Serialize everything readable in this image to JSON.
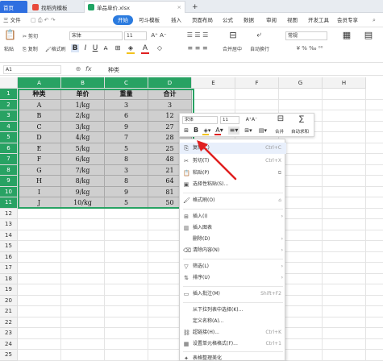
{
  "tabs": [
    {
      "label": "首页"
    },
    {
      "label": "找稻壳模板"
    },
    {
      "label": "单品单价.xlsx"
    },
    {
      "label": "+"
    }
  ],
  "menu": {
    "file": "三 文件",
    "items": [
      "开始",
      "插入",
      "页面布局",
      "公式",
      "数据",
      "审阅",
      "视图",
      "开发工具",
      "会员专享"
    ],
    "start": "开始",
    "insert": "插入",
    "page_layout": "页面布局",
    "formula": "公式",
    "data": "数据",
    "review": "审阅",
    "view": "视图",
    "dev": "开发工具",
    "member": "会员专享"
  },
  "ribbon": {
    "cut": "剪切",
    "paste": "粘贴",
    "copy": "复制",
    "format_painter": "格式刷",
    "font_name": "宋体",
    "font_size": "11",
    "merge_center": "合并居中",
    "wrap_text": "自动换行",
    "general": "常规"
  },
  "formula_bar": {
    "name_box": "A1",
    "fx": "fx",
    "content": "种类"
  },
  "columns": [
    "A",
    "B",
    "C",
    "D",
    "E",
    "F",
    "G",
    "H"
  ],
  "rows": [
    "1",
    "2",
    "3",
    "4",
    "5",
    "6",
    "7",
    "8",
    "9",
    "10",
    "11",
    "12",
    "13",
    "14",
    "15",
    "16",
    "17",
    "18",
    "19",
    "20",
    "21",
    "22",
    "23",
    "24",
    "25"
  ],
  "table": {
    "headers": [
      "种类",
      "单价",
      "重量",
      "合计"
    ],
    "rows": [
      [
        "A",
        "1/kg",
        "3",
        "3"
      ],
      [
        "B",
        "2/kg",
        "6",
        "12"
      ],
      [
        "C",
        "3/kg",
        "9",
        "27"
      ],
      [
        "D",
        "4/kg",
        "7",
        "28"
      ],
      [
        "E",
        "5/kg",
        "5",
        "25"
      ],
      [
        "F",
        "6/kg",
        "8",
        "48"
      ],
      [
        "G",
        "7/kg",
        "3",
        "21"
      ],
      [
        "H",
        "8/kg",
        "8",
        "64"
      ],
      [
        "I",
        "9/kg",
        "9",
        "81"
      ],
      [
        "J",
        "10/kg",
        "5",
        "50"
      ]
    ]
  },
  "mini_toolbar": {
    "font_name": "宋体",
    "font_size": "11",
    "merge": "合并",
    "auto_sum": "自动求和"
  },
  "context_menu": [
    {
      "label": "复制(C)",
      "shortcut": "Ctrl+C"
    },
    {
      "label": "剪切(T)",
      "shortcut": "Ctrl+X"
    },
    {
      "label": "粘贴(P)",
      "shortcut": ""
    },
    {
      "label": "选择性粘贴(S)...",
      "shortcut": ""
    },
    {
      "label": "格式刷(O)",
      "shortcut": ""
    },
    {
      "label": "插入(I)",
      "shortcut": ""
    },
    {
      "label": "插入图表",
      "shortcut": ""
    },
    {
      "label": "删除(D)",
      "shortcut": ""
    },
    {
      "label": "清除内容(N)",
      "shortcut": ""
    },
    {
      "label": "筛选(L)",
      "shortcut": ""
    },
    {
      "label": "排序(U)",
      "shortcut": ""
    },
    {
      "label": "插入批注(M)",
      "shortcut": "Shift+F2"
    },
    {
      "label": "从下拉列表中选择(K)...",
      "shortcut": ""
    },
    {
      "label": "定义名称(A)...",
      "shortcut": ""
    },
    {
      "label": "超链接(H)...",
      "shortcut": "Ctrl+K"
    },
    {
      "label": "设置单元格格式(F)...",
      "shortcut": "Ctrl+1"
    },
    {
      "label": "表格整理美化",
      "shortcut": ""
    }
  ],
  "colors": {
    "selection_green": "#28a263",
    "cell_gray": "#cfcfcf",
    "arrow_red": "#e02020",
    "start_blue": "#2b7bdf"
  }
}
